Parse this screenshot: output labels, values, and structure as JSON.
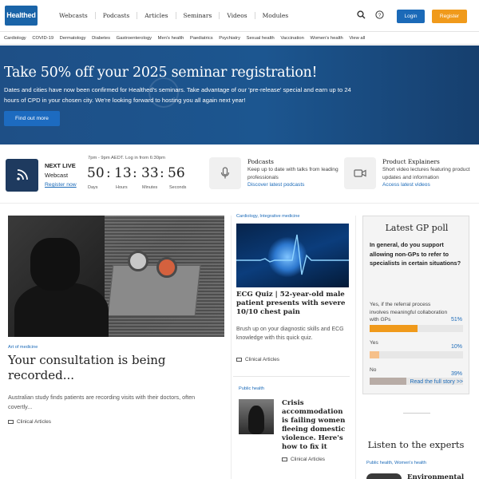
{
  "header": {
    "logo_text": "Healthed",
    "nav": [
      "Webcasts",
      "Podcasts",
      "Articles",
      "Seminars",
      "Videos",
      "Modules"
    ],
    "login_label": "Login",
    "register_label": "Register",
    "icons": [
      "search-icon",
      "help-icon"
    ]
  },
  "categories": [
    "Cardiology",
    "COVID-19",
    "Dermatology",
    "Diabetes",
    "Gastroenterology",
    "Men's health",
    "Paediatrics",
    "Psychiatry",
    "Sexual health",
    "Vaccination",
    "Women's health",
    "View all"
  ],
  "banner": {
    "title": "Take 50% off your 2025 seminar registration!",
    "text": "Dates and cities have now been confirmed for Healthed's seminars. Take advantage of our 'pre-release' special and earn up to 24 hours of CPD in your chosen city. We're looking forward to hosting you all again next year!",
    "cta": "Find out more"
  },
  "next_live": {
    "heading": "NEXT LIVE",
    "type": "Webcast",
    "register": "Register now",
    "time_note": "7pm - 9pm AEDT. Log in from 6:30pm",
    "countdown": [
      {
        "value": "50",
        "unit": "Days"
      },
      {
        "value": "13",
        "unit": "Hours"
      },
      {
        "value": "33",
        "unit": "Minutes"
      },
      {
        "value": "56",
        "unit": "Seconds"
      }
    ]
  },
  "podcasts": {
    "title": "Podcasts",
    "text": "Keep up to date with talks from leading professionals",
    "link": "Discover latest podcasts"
  },
  "explainers": {
    "title": "Product Explainers",
    "text": "Short video lectures featuring product updates and information",
    "link": "Access latest videos"
  },
  "featured": {
    "category": "Art of medicine",
    "title": "Your consultation is being recorded...",
    "excerpt": "Australian study finds patients are recording visits with their doctors, often covertly...",
    "meta": "Clinical Articles"
  },
  "ecg_article": {
    "category": "Cardiology, Integrative medicine",
    "title": "ECG Quiz | 52-year-old male patient presents with severe 10/10 chest pain",
    "excerpt": "Brush up on your diagnostic skills and ECG knowledge with this quick quiz.",
    "meta": "Clinical Articles"
  },
  "crisis_article": {
    "category": "Public health",
    "title": "Crisis accommodation is failing women fleeing domestic violence. Here's how to fix it",
    "meta": "Clinical Articles"
  },
  "poll": {
    "title": "Latest GP poll",
    "question": "In general, do you support allowing non-GPs to refer to specialists in certain situations?",
    "options": [
      {
        "label": "Yes, if the referral process involves meaningful collaboration with GPs",
        "percent": "51%",
        "fraction": 0.51,
        "color": "#f09a1b"
      },
      {
        "label": "Yes",
        "percent": "10%",
        "fraction": 0.1,
        "color": "#f6c08a"
      },
      {
        "label": "No",
        "percent": "39%",
        "fraction": 0.39,
        "color": "#b8aca6"
      }
    ],
    "read_more": "Read the full story >>"
  },
  "listen": {
    "title": "Listen to the experts",
    "category": "Public health, Women's health",
    "item_title": "Environmental"
  }
}
